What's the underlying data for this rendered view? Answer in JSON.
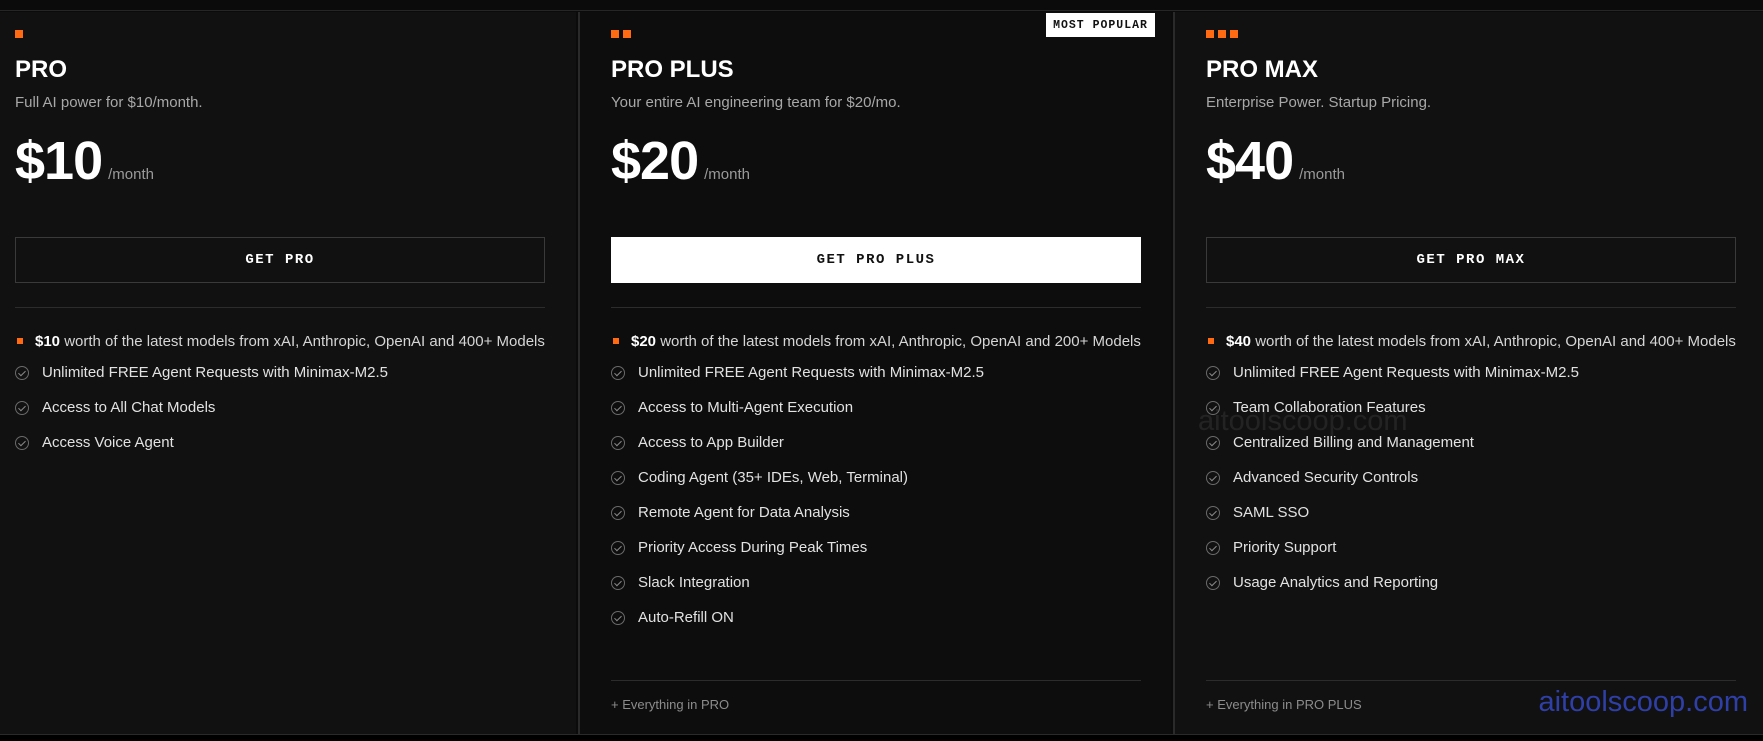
{
  "plans": [
    {
      "id": "pro",
      "name": "PRO",
      "tagline": "Full AI power for $10/month.",
      "price": "$10",
      "period": "/month",
      "cta": "GET PRO",
      "first_feature_bold": "$10",
      "first_feature_text": " worth of the latest models from xAI, Anthropic, OpenAI and 400+ Models",
      "features": [
        "Unlimited FREE Agent Requests with Minimax-M2.5",
        "Access to All Chat Models",
        "Access Voice Agent"
      ]
    },
    {
      "id": "pro-plus",
      "name": "PRO PLUS",
      "badge": "MOST POPULAR",
      "tagline": "Your entire AI engineering team for $20/mo.",
      "price": "$20",
      "period": "/month",
      "cta": "GET PRO PLUS",
      "first_feature_bold": "$20",
      "first_feature_text": " worth of the latest models from xAI, Anthropic, OpenAI and 200+ Models",
      "features": [
        "Unlimited FREE Agent Requests with Minimax-M2.5",
        "Access to Multi-Agent Execution",
        "Access to App Builder",
        "Coding Agent (35+ IDEs, Web, Terminal)",
        "Remote Agent for Data Analysis",
        "Priority Access During Peak Times",
        "Slack Integration",
        "Auto-Refill ON"
      ],
      "everything": "+ Everything in PRO"
    },
    {
      "id": "pro-max",
      "name": "PRO MAX",
      "tagline": "Enterprise Power. Startup Pricing.",
      "price": "$40",
      "period": "/month",
      "cta": "GET PRO MAX",
      "first_feature_bold": "$40",
      "first_feature_text": " worth of the latest models from xAI, Anthropic, OpenAI and 400+ Models",
      "features": [
        "Unlimited FREE Agent Requests with Minimax-M2.5",
        "Team Collaboration Features",
        "Centralized Billing and Management",
        "Advanced Security Controls",
        "SAML SSO",
        "Priority Support",
        "Usage Analytics and Reporting"
      ],
      "everything": "+ Everything in PRO PLUS"
    }
  ],
  "watermark": "aitoolscoop.com",
  "colors": {
    "accent": "#ff6a13",
    "background": "#0b0b0b",
    "card": "#111111"
  }
}
